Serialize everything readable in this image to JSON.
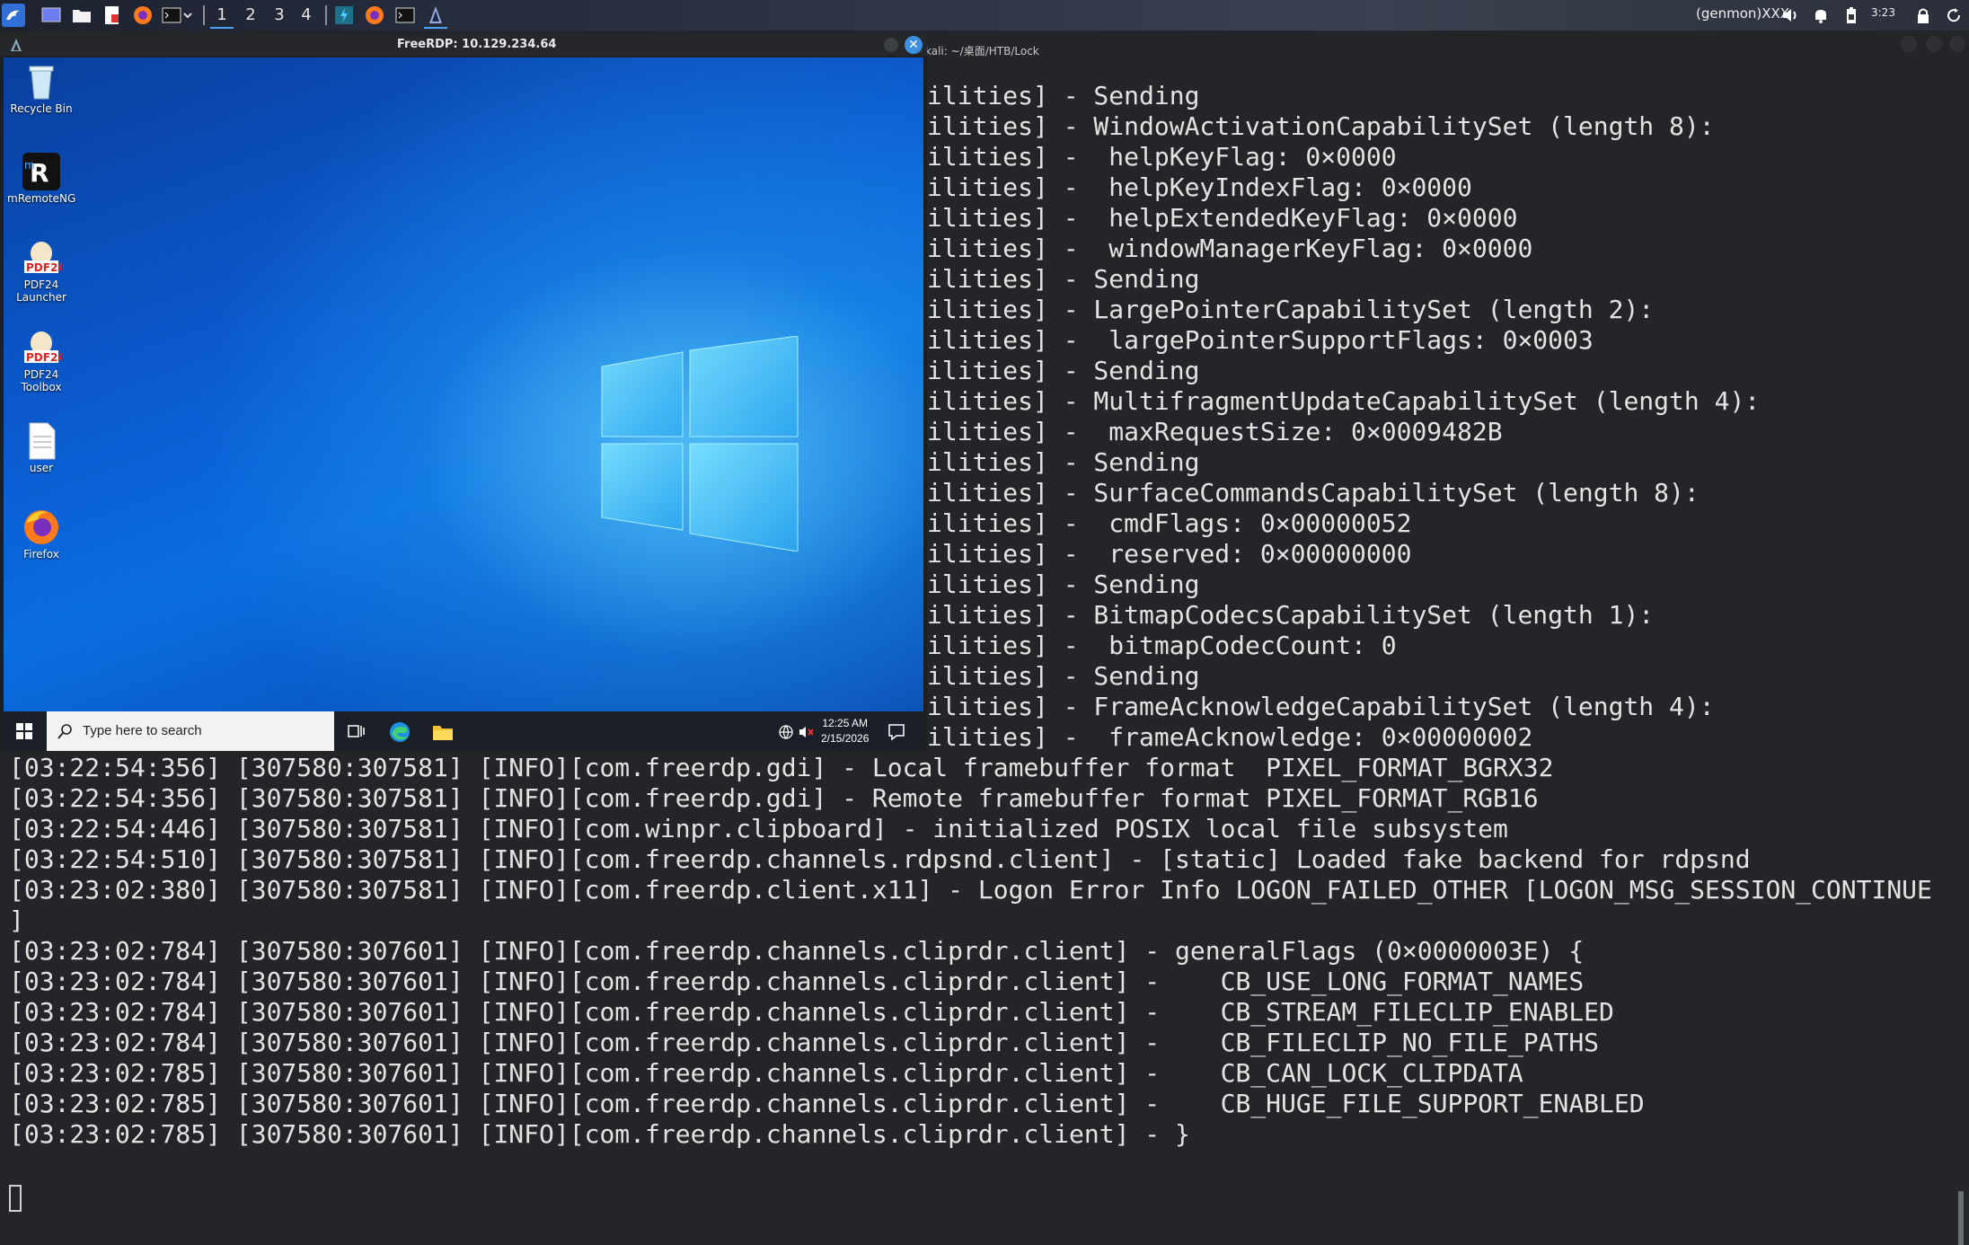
{
  "top_panel": {
    "workspaces": [
      "1",
      "2",
      "3",
      "4"
    ],
    "active_workspace": "1",
    "user": "(genmon)XXX",
    "time": "3:23"
  },
  "terminal": {
    "title": "kali: ~/桌面/HTB/Lock",
    "right_lines": [
      "ilities] - Sending",
      "ilities] - WindowActivationCapabilitySet (length 8):",
      "ilities] -  helpKeyFlag: 0×0000",
      "ilities] -  helpKeyIndexFlag: 0×0000",
      "ilities] -  helpExtendedKeyFlag: 0×0000",
      "ilities] -  windowManagerKeyFlag: 0×0000",
      "ilities] - Sending",
      "ilities] - LargePointerCapabilitySet (length 2):",
      "ilities] -  largePointerSupportFlags: 0×0003",
      "ilities] - Sending",
      "ilities] - MultifragmentUpdateCapabilitySet (length 4):",
      "ilities] -  maxRequestSize: 0×0009482B",
      "ilities] - Sending",
      "ilities] - SurfaceCommandsCapabilitySet (length 8):",
      "ilities] -  cmdFlags: 0×00000052",
      "ilities] -  reserved: 0×00000000",
      "ilities] - Sending",
      "ilities] - BitmapCodecsCapabilitySet (length 1):",
      "ilities] -  bitmapCodecCount: 0",
      "ilities] - Sending",
      "ilities] - FrameAcknowledgeCapabilitySet (length 4):",
      "ilities] -  frameAcknowledge: 0×00000002"
    ],
    "full_lines": [
      "[03:22:54:356] [307580:307581] [INFO][com.freerdp.gdi] - Local framebuffer format  PIXEL_FORMAT_BGRX32",
      "[03:22:54:356] [307580:307581] [INFO][com.freerdp.gdi] - Remote framebuffer format PIXEL_FORMAT_RGB16",
      "[03:22:54:446] [307580:307581] [INFO][com.winpr.clipboard] - initialized POSIX local file subsystem",
      "[03:22:54:510] [307580:307581] [INFO][com.freerdp.channels.rdpsnd.client] - [static] Loaded fake backend for rdpsnd",
      "[03:23:02:380] [307580:307581] [INFO][com.freerdp.client.x11] - Logon Error Info LOGON_FAILED_OTHER [LOGON_MSG_SESSION_CONTINUE",
      "]",
      "[03:23:02:784] [307580:307601] [INFO][com.freerdp.channels.cliprdr.client] - generalFlags (0×0000003E) {",
      "[03:23:02:784] [307580:307601] [INFO][com.freerdp.channels.cliprdr.client] -    CB_USE_LONG_FORMAT_NAMES",
      "[03:23:02:784] [307580:307601] [INFO][com.freerdp.channels.cliprdr.client] -    CB_STREAM_FILECLIP_ENABLED",
      "[03:23:02:784] [307580:307601] [INFO][com.freerdp.channels.cliprdr.client] -    CB_FILECLIP_NO_FILE_PATHS",
      "[03:23:02:785] [307580:307601] [INFO][com.freerdp.channels.cliprdr.client] -    CB_CAN_LOCK_CLIPDATA",
      "[03:23:02:785] [307580:307601] [INFO][com.freerdp.channels.cliprdr.client] -    CB_HUGE_FILE_SUPPORT_ENABLED",
      "[03:23:02:785] [307580:307601] [INFO][com.freerdp.channels.cliprdr.client] - }"
    ]
  },
  "rdp": {
    "title": "FreeRDP: 10.129.234.64",
    "desktop_icons": [
      {
        "label": "Recycle Bin",
        "icon": "recycle-bin-icon"
      },
      {
        "label": "mRemoteNG",
        "icon": "mremoteng-icon"
      },
      {
        "label": "PDF24 Launcher",
        "icon": "pdf24-launcher-icon"
      },
      {
        "label": "PDF24 Toolbox",
        "icon": "pdf24-toolbox-icon"
      },
      {
        "label": "user",
        "icon": "text-file-icon"
      },
      {
        "label": "Firefox",
        "icon": "firefox-icon"
      }
    ],
    "taskbar": {
      "search_placeholder": "Type here to search",
      "time": "12:25 AM",
      "date": "2/15/2026"
    }
  },
  "colors": {
    "terminal_bg": "#232528",
    "terminal_fg": "#e3e3e3",
    "accent": "#3d8fe0"
  }
}
